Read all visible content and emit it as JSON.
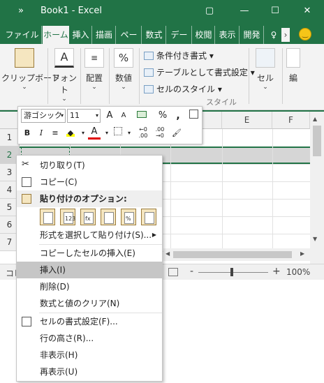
{
  "window": {
    "title": "Book1 - Excel",
    "quick_access_more": "»",
    "buttons": {
      "restore": "▢",
      "minimize": "—",
      "maximize": "☐",
      "close": "✕"
    }
  },
  "tabs": [
    "ファイル",
    "ホーム",
    "挿入",
    "描画",
    "ページ",
    "数式",
    "データ",
    "校閲",
    "表示",
    "開発",
    "♀"
  ],
  "ribbon": {
    "clipboard": "クリップボード",
    "font": "フォント",
    "alignment": "配置",
    "number": "数値",
    "conditional": "条件付き書式",
    "table_format": "テーブルとして書式設定",
    "cell_style": "セルのスタイル",
    "style_group": "スタイル",
    "cells": "セル",
    "edit": "編"
  },
  "mini_toolbar": {
    "font_name": "游ゴシック",
    "font_size": "11",
    "grow": "A",
    "shrink": "A",
    "percent": "%",
    "comma": ",",
    "bold": "B",
    "italic": "I",
    "font_color_letter": "A",
    "decimal_inc": "←0\n.00",
    "decimal_dec": ".00\n→0"
  },
  "grid": {
    "columns": [
      "E",
      "F"
    ],
    "rows": [
      "1",
      "2",
      "3",
      "4",
      "5",
      "6",
      "7"
    ]
  },
  "context_menu": {
    "items": [
      {
        "label": "切り取り(T)"
      },
      {
        "label": "コピー(C)"
      },
      {
        "label": "貼り付けのオプション:"
      },
      {
        "label": "形式を選択して貼り付け(S)..."
      },
      {
        "label": "コピーしたセルの挿入(E)"
      },
      {
        "label": "挿入(I)"
      },
      {
        "label": "削除(D)"
      },
      {
        "label": "数式と値のクリア(N)"
      },
      {
        "label": "セルの書式設定(F)..."
      },
      {
        "label": "行の高さ(R)..."
      },
      {
        "label": "非表示(H)"
      },
      {
        "label": "再表示(U)"
      }
    ],
    "paste_option_labels": [
      "",
      "123",
      "fx",
      "",
      "%",
      ""
    ]
  },
  "status": {
    "left": "コピ",
    "zoom_minus": "-",
    "zoom_plus": "+",
    "zoom": "100%"
  },
  "colors": {
    "excel_green": "#217346",
    "hover": "#c6c6c6"
  }
}
